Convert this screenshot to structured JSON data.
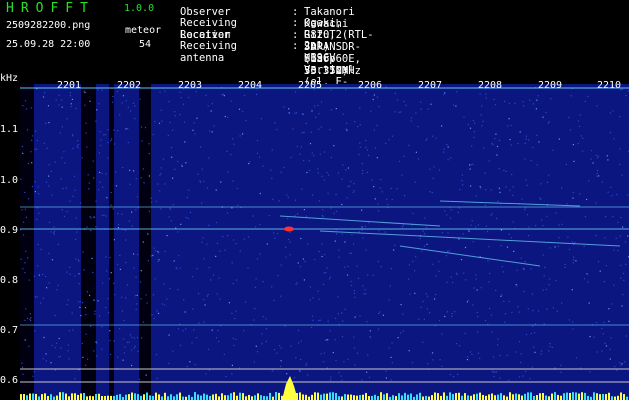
{
  "header": {
    "app_title": "HROFFT",
    "version": "1.0.0",
    "filename": "2509282200.png",
    "meteor_label": "meteor",
    "datetime": "25.09.28 22:00",
    "meteor_count": "54"
  },
  "info": [
    {
      "label": "Observer",
      "value": "Takanori Kawachi"
    },
    {
      "label": "Receiving Location",
      "value": "Ogaki, Gifu, JAPAN (136.60E, 35.35N)"
    },
    {
      "label": "Receiver",
      "value": "R820T2(RTL-SDR) SDR-Sharp 53.372MHz"
    },
    {
      "label": "Receiving antenna",
      "value": "2el-HB9CV Vertical (el. E-W)"
    }
  ],
  "axis": {
    "y_unit": "kHz",
    "y_ticks": [
      "1.1",
      "1.0",
      "0.9",
      "0.8",
      "0.7",
      "0.6"
    ],
    "x_ticks": [
      "2201",
      "2202",
      "2203",
      "2204",
      "2205",
      "2206",
      "2207",
      "2208",
      "2209",
      "2210"
    ]
  },
  "colors": {
    "background": "#000000",
    "title_green": "#28e028",
    "spectrogram_blue": "#0b1680",
    "signal_cyan": "#6fd8ff",
    "meteor_red": "#ff3030",
    "baseline_yellow": "#ffff40",
    "baseline_cyan": "#30e0ff"
  }
}
